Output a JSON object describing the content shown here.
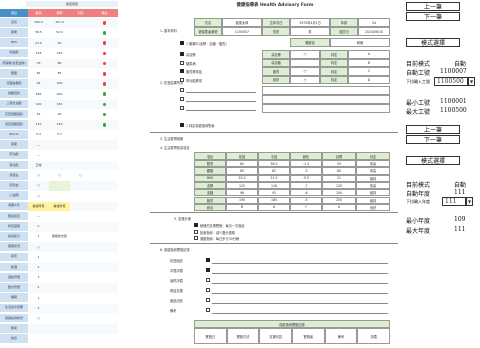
{
  "left": {
    "title": "檢查項目",
    "headers": [
      "項目",
      "數值",
      "標準",
      "判定",
      "備註"
    ],
    "header_colors": [
      "#4a90c8",
      "#f08080",
      "#f08080",
      "#f08080",
      "#f08080"
    ],
    "rows": [
      {
        "label": "身高",
        "v1": "165.0",
        "v2": "157.0",
        "v3": "",
        "dot": "#e84040"
      },
      {
        "label": "體重",
        "v1": "58.5",
        "v2": "52.0",
        "v3": "",
        "dot": "#40a040"
      },
      {
        "label": "BMI",
        "v1": "21.5",
        "v2": "20",
        "v3": "",
        "dot": "#e84040"
      },
      {
        "label": "收縮壓",
        "v1": "118",
        "v2": "120",
        "v3": "",
        "dot": "#e84040"
      },
      {
        "label": "舒張壓(最低血壓)",
        "v1": "76",
        "v2": "80",
        "v3": "",
        "dot": "#e84040"
      },
      {
        "label": "腰圍",
        "v1": "82",
        "v2": "85",
        "v3": "",
        "dot": "#e84040"
      },
      {
        "label": "空腹血糖值",
        "v1": "92",
        "v2": "100",
        "v3": "",
        "dot": "#e84040"
      },
      {
        "label": "總膽固醇",
        "v1": "185",
        "v2": "200",
        "v3": "",
        "dot": "#40a040"
      },
      {
        "label": "三酸甘油酯",
        "v1": "120",
        "v2": "150",
        "v3": "",
        "dot": "#40a040"
      },
      {
        "label": "高密度膽固醇",
        "v1": "52",
        "v2": "40",
        "v3": "",
        "dot": "#40a040"
      },
      {
        "label": "低密度膽固醇",
        "v1": "110",
        "v2": "130",
        "v3": "",
        "dot": "#40a040"
      },
      {
        "label": "HbA1c",
        "v1": "5.4",
        "v2": "5.7",
        "v3": "",
        "dot": ""
      },
      {
        "label": "尿酸",
        "v1": "—",
        "v2": "",
        "v3": "",
        "dot": ""
      },
      {
        "label": "肝功能",
        "v1": "—",
        "v2": "",
        "v3": "",
        "dot": ""
      },
      {
        "label": "腎功能",
        "v1": "正常",
        "v2": "",
        "v3": "",
        "dot": ""
      },
      {
        "label": "尿蛋白",
        "v1": "○",
        "v2": "○",
        "v3": "○",
        "dot": ""
      },
      {
        "label": "尿潛血",
        "v1": "○",
        "v2": "",
        "v3": "",
        "dot": ""
      },
      {
        "label": "心電圖",
        "v1": "○",
        "v2": "",
        "v3": "",
        "dot": ""
      },
      {
        "label": "胸部X光",
        "v1": "異常所見",
        "v2": "異常所見",
        "v3": "",
        "dot": ""
      },
      {
        "label": "眼底檢查",
        "v1": "—",
        "v2": "",
        "v3": "",
        "dot": ""
      },
      {
        "label": "判定結果",
        "v1": "C",
        "v2": "",
        "v3": "",
        "dot": ""
      },
      {
        "label": "指導區分",
        "v1": "1",
        "v2": "積極的支援",
        "v3": "",
        "dot": ""
      },
      {
        "label": "服藥狀況",
        "v1": "○",
        "v2": "",
        "v3": "",
        "dot": ""
      },
      {
        "label": "吸菸",
        "v1": "1",
        "v2": "",
        "v3": "",
        "dot": ""
      },
      {
        "label": "飲酒",
        "v1": "2",
        "v2": "",
        "v3": "",
        "dot": ""
      },
      {
        "label": "運動習慣",
        "v1": "1",
        "v2": "",
        "v3": "",
        "dot": ""
      },
      {
        "label": "飲食習慣",
        "v1": "2",
        "v2": "",
        "v3": "",
        "dot": ""
      },
      {
        "label": "睡眠",
        "v1": "1",
        "v2": "",
        "v3": "",
        "dot": ""
      },
      {
        "label": "生活改善意願",
        "v1": "3",
        "v2": "",
        "v3": "",
        "dot": ""
      },
      {
        "label": "保健指導希望",
        "v1": "○",
        "v2": "",
        "v3": "",
        "dot": ""
      },
      {
        "label": "備考",
        "v1": "",
        "v2": "",
        "v3": "",
        "dot": ""
      },
      {
        "label": "總合",
        "v1": "",
        "v2": "",
        "v3": "",
        "dot": ""
      }
    ]
  },
  "form": {
    "title": "健康指導表 Health Advisory Form",
    "sec1": "1. 基本資料",
    "name_label": "氏名",
    "name_value": "健康太郎",
    "birth_label": "生年月日",
    "birth_value": "1970年4月1日",
    "age_label": "年齡",
    "age_value": "54",
    "id_label": "被保險者番號",
    "id_value": "1100007",
    "sex_label": "性別",
    "sex_value": "男",
    "exam_label": "健診日",
    "exam_value": "2024/06/15",
    "level_label": "階層化",
    "level_value": "積極",
    "opt1": "1 服藥中(血壓・血糖・脂質)",
    "opt2": "2 特定保健指導對象",
    "sec2": "2. 檢查結果所見",
    "chk_items": [
      "高血壓",
      "糖尿病",
      "脂質異常症",
      "肝功能異常"
    ],
    "chk_vals": [
      "是",
      "否",
      "是",
      "否"
    ],
    "sub_labels": [
      "高血壓",
      "高血糖",
      "脂質",
      "吸菸"
    ],
    "sub_vals": [
      "○",
      "",
      "○",
      "○"
    ],
    "right_labels": [
      "判定",
      "判定",
      "判定",
      "判定"
    ],
    "right_vals": [
      "A",
      "B",
      "C",
      "D"
    ],
    "sec3": "3. 生活習慣相關",
    "habits_title": "4. 生活習慣改善項目",
    "grid_headers": [
      "項目",
      "前回",
      "今回",
      "變化",
      "目標",
      "判定"
    ],
    "grid_rows": [
      [
        "體重",
        "60",
        "58.5",
        "-1.5",
        "55",
        "改善"
      ],
      [
        "腰圍",
        "85",
        "82",
        "-3",
        "80",
        "改善"
      ],
      [
        "BMI",
        "22.0",
        "21.5",
        "-0.5",
        "21",
        "維持"
      ],
      [
        "血壓",
        "125",
        "118",
        "-7",
        "120",
        "改善"
      ],
      [
        "血糖",
        "98",
        "92",
        "-6",
        "100",
        "維持"
      ],
      [
        "脂質",
        "190",
        "185",
        "-5",
        "200",
        "維持"
      ],
      [
        "综合",
        "B",
        "A",
        "↑",
        "A",
        "良好"
      ]
    ],
    "sec4_label": "5. 支援計畫",
    "advice_lines": [
      "積極的支援實施：每月一次面談",
      "飲食指導：減少鹽分攝取",
      "運動指導：每日步行30分鐘"
    ],
    "sec5": "6. 保健指導實施記錄",
    "bottom_labels": [
      "初回面談",
      "中間評價",
      "最終評價",
      "電話支援",
      "面談記錄",
      "備考"
    ],
    "bottom_title": "保健指導實施記錄",
    "bottom_row_label": "實施日",
    "bottom_cols": [
      "實施日",
      "實施方法",
      "支援內容",
      "實施者",
      "備考",
      "評價"
    ]
  },
  "right": {
    "prev_label": "上一筆",
    "next_label": "下一筆",
    "mode_label": "模式選擇",
    "current_mode_label": "目前模式",
    "current_mode_value": "自動",
    "auto_id_label": "自動工號",
    "auto_id_value": "1100007",
    "dropdown_label": "下拉輸入工號",
    "dropdown_value": "1100500",
    "min_id_label": "最小工號",
    "min_id_value": "1100001",
    "max_id_label": "最大工號",
    "max_id_value": "1100500",
    "prev_label2": "上一筆",
    "next_label2": "下一筆",
    "mode_label2": "模式選擇",
    "current_mode_label2": "目前模式",
    "current_mode_value2": "自動",
    "auto_year_label": "自動年度",
    "auto_year_value": "111",
    "dropdown_year_label": "下拉輸入年度",
    "dropdown_year_value": "111",
    "min_year_label": "最小年度",
    "min_year_value": "109",
    "max_year_label": "最大年度",
    "max_year_value": "111"
  }
}
